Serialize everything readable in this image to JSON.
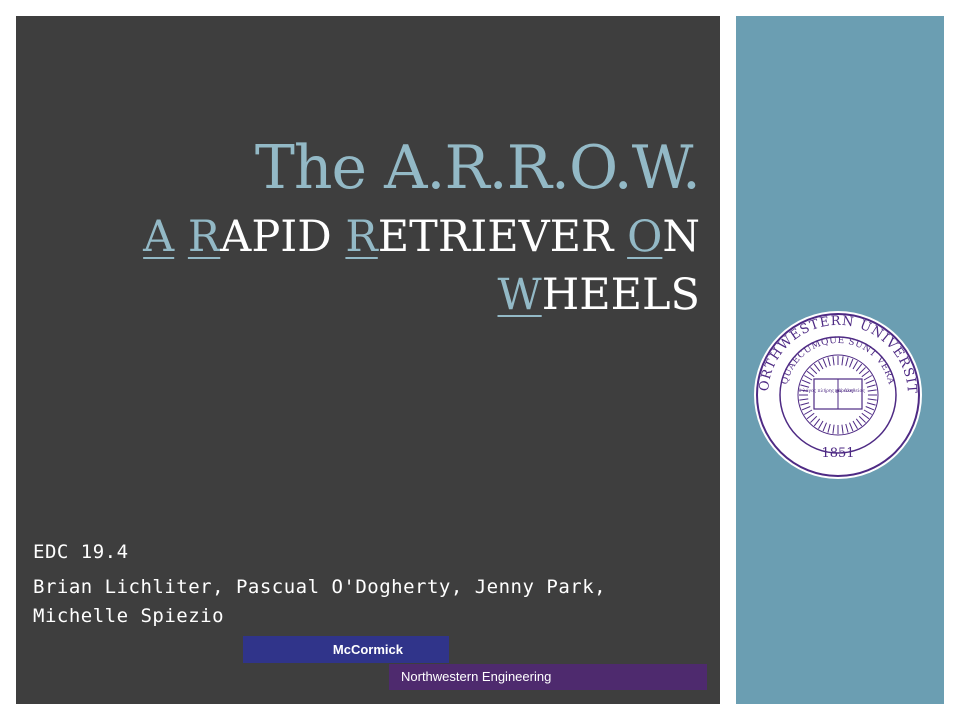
{
  "slide": {
    "title": "The A.R.R.O.W.",
    "subtitle_line1": [
      {
        "text": "A",
        "accent": true
      },
      {
        "text": " ",
        "accent": false
      },
      {
        "text": "R",
        "accent": true
      },
      {
        "text": "apid ",
        "accent": false
      },
      {
        "text": "R",
        "accent": true
      },
      {
        "text": "etriever ",
        "accent": false
      },
      {
        "text": "O",
        "accent": true
      },
      {
        "text": "n",
        "accent": false
      }
    ],
    "subtitle_line2": [
      {
        "text": "W",
        "accent": true
      },
      {
        "text": "heels",
        "accent": false
      }
    ],
    "course": "EDC 19.4",
    "authors": "Brian Lichliter, Pascual O'Dogherty, Jenny Park, Michelle Spiezio"
  },
  "branding": {
    "mccormick_label": "McCormick",
    "engineering_label": "Northwestern Engineering"
  },
  "seal": {
    "ring_text": "NORTHWESTERN UNIVERSITY",
    "motto_text": "QUAECUMQUE SUNT VERA",
    "year": "1851",
    "book_left": "ὁ λόγος πλήρης χάριτος",
    "book_right": "καὶ ἀληθείας"
  },
  "colors": {
    "main_bg": "#3e3e3e",
    "accent": "#93b9c6",
    "side_panel": "#6b9eb2",
    "mccormick_bar": "#30348a",
    "engineering_bar": "#4e2a6e",
    "seal_purple": "#4e2a84"
  }
}
